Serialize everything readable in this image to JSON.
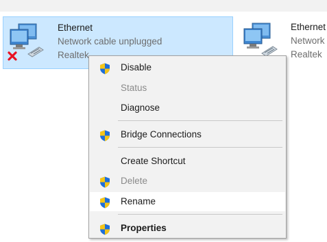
{
  "adapters": [
    {
      "name": "Ethernet",
      "status": "Network cable unplugged",
      "device": "Realtek",
      "icon": "network-adapter-disconnected-icon"
    },
    {
      "name": "Ethernet",
      "status": "Network",
      "device": "Realtek",
      "icon": "network-adapter-icon"
    }
  ],
  "context_menu": {
    "items": [
      {
        "label": "Disable",
        "icon": "uac-shield-icon",
        "enabled": true
      },
      {
        "label": "Status",
        "enabled": false
      },
      {
        "label": "Diagnose",
        "enabled": true
      },
      {
        "label": "Bridge Connections",
        "icon": "uac-shield-icon",
        "enabled": true
      },
      {
        "label": "Create Shortcut",
        "enabled": true
      },
      {
        "label": "Delete",
        "icon": "uac-shield-icon",
        "enabled": false
      },
      {
        "label": "Rename",
        "icon": "uac-shield-icon",
        "enabled": true,
        "hovered": true
      },
      {
        "label": "Properties",
        "icon": "uac-shield-icon",
        "enabled": true,
        "default": true
      }
    ]
  },
  "colors": {
    "selection_fill": "#cce8ff",
    "selection_border": "#99d1ff",
    "menu_background": "#f2f2f2",
    "shield_blue": "#1e6fd9",
    "shield_yellow": "#f5c518",
    "error_red": "#e81123"
  }
}
